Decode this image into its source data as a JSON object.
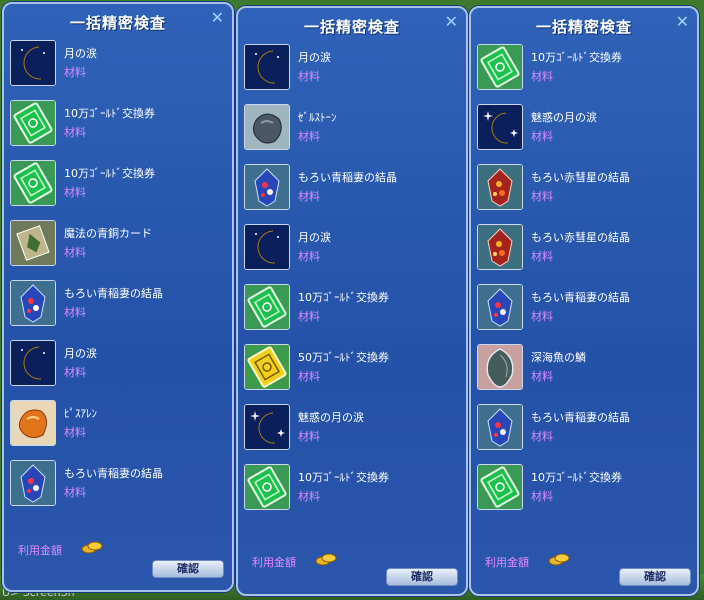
{
  "screen_label": "U> ScreenSh",
  "panels": [
    {
      "title": "一括精密検査",
      "close": "✕",
      "footer_label": "利用金額",
      "confirm": "確認",
      "items": [
        {
          "name": "月の涙",
          "type": "材料",
          "icon": "moon-tear"
        },
        {
          "name": "10万ｺﾞｰﾙﾄﾞ交換券",
          "type": "材料",
          "icon": "gold-voucher-green"
        },
        {
          "name": "10万ｺﾞｰﾙﾄﾞ交換券",
          "type": "材料",
          "icon": "gold-voucher-green"
        },
        {
          "name": "魔法の青銅カード",
          "type": "材料",
          "icon": "bronze-card"
        },
        {
          "name": "もろい青稲妻の結晶",
          "type": "材料",
          "icon": "blue-crystal"
        },
        {
          "name": "月の涙",
          "type": "材料",
          "icon": "moon-tear"
        },
        {
          "name": "ﾋﾟｽｱﾚﾝ",
          "type": "材料",
          "icon": "orange-ore"
        },
        {
          "name": "もろい青稲妻の結晶",
          "type": "材料",
          "icon": "blue-crystal"
        }
      ]
    },
    {
      "title": "一括精密検査",
      "close": "✕",
      "footer_label": "利用金額",
      "confirm": "確認",
      "items": [
        {
          "name": "月の涙",
          "type": "材料",
          "icon": "moon-tear"
        },
        {
          "name": "ｾﾞﾙｽﾄｰﾝ",
          "type": "材料",
          "icon": "zel-stone"
        },
        {
          "name": "もろい青稲妻の結晶",
          "type": "材料",
          "icon": "blue-crystal"
        },
        {
          "name": "月の涙",
          "type": "材料",
          "icon": "moon-tear"
        },
        {
          "name": "10万ｺﾞｰﾙﾄﾞ交換券",
          "type": "材料",
          "icon": "gold-voucher-green"
        },
        {
          "name": "50万ｺﾞｰﾙﾄﾞ交換券",
          "type": "材料",
          "icon": "gold-voucher-yellow"
        },
        {
          "name": "魅惑の月の涙",
          "type": "材料",
          "icon": "charm-moon-tear"
        },
        {
          "name": "10万ｺﾞｰﾙﾄﾞ交換券",
          "type": "材料",
          "icon": "gold-voucher-green"
        }
      ]
    },
    {
      "title": "一括精密検査",
      "close": "✕",
      "footer_label": "利用金額",
      "confirm": "確認",
      "items": [
        {
          "name": "10万ｺﾞｰﾙﾄﾞ交換券",
          "type": "材料",
          "icon": "gold-voucher-green"
        },
        {
          "name": "魅惑の月の涙",
          "type": "材料",
          "icon": "charm-moon-tear"
        },
        {
          "name": "もろい赤彗星の結晶",
          "type": "材料",
          "icon": "red-crystal"
        },
        {
          "name": "もろい赤彗星の結晶",
          "type": "材料",
          "icon": "red-crystal"
        },
        {
          "name": "もろい青稲妻の結晶",
          "type": "材料",
          "icon": "blue-crystal"
        },
        {
          "name": "深海魚の鱗",
          "type": "材料",
          "icon": "fish-scale"
        },
        {
          "name": "もろい青稲妻の結晶",
          "type": "材料",
          "icon": "blue-crystal"
        },
        {
          "name": "10万ｺﾞｰﾙﾄﾞ交換券",
          "type": "材料",
          "icon": "gold-voucher-green"
        }
      ]
    }
  ]
}
